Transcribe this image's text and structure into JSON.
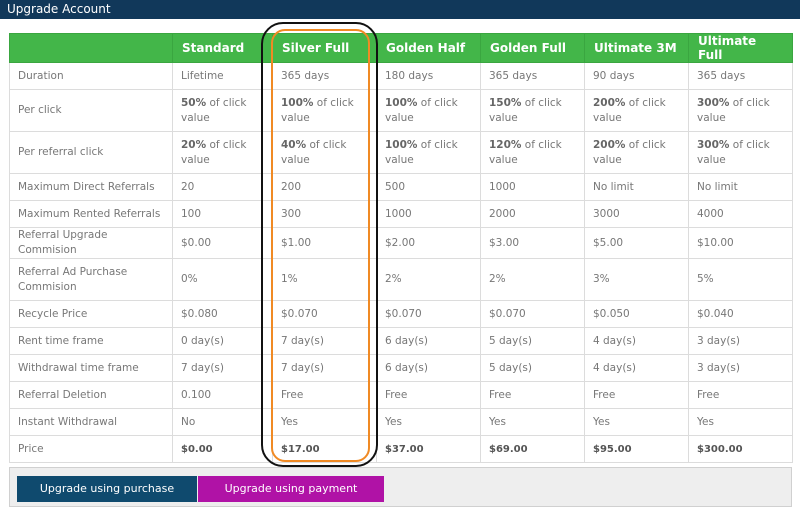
{
  "window": {
    "title": "Upgrade Account"
  },
  "table": {
    "columns": [
      "",
      "Standard",
      "Silver Full",
      "Golden Half",
      "Golden Full",
      "Ultimate 3M",
      "Ultimate Full"
    ],
    "rows": [
      {
        "label": "Duration",
        "cells": [
          {
            "text": "Lifetime"
          },
          {
            "text": "365 days"
          },
          {
            "text": "180 days"
          },
          {
            "text": "365 days"
          },
          {
            "text": "90 days"
          },
          {
            "text": "365 days"
          }
        ]
      },
      {
        "label": "Per click",
        "cells": [
          {
            "bold": "50%",
            "text": " of click value"
          },
          {
            "bold": "100%",
            "text": " of click value"
          },
          {
            "bold": "100%",
            "text": " of click value"
          },
          {
            "bold": "150%",
            "text": " of click value"
          },
          {
            "bold": "200%",
            "text": " of click value"
          },
          {
            "bold": "300%",
            "text": " of click value"
          }
        ]
      },
      {
        "label": "Per referral click",
        "cells": [
          {
            "bold": "20%",
            "text": " of click value"
          },
          {
            "bold": "40%",
            "text": " of click value"
          },
          {
            "bold": "100%",
            "text": " of click value"
          },
          {
            "bold": "120%",
            "text": " of click value"
          },
          {
            "bold": "200%",
            "text": " of click value"
          },
          {
            "bold": "300%",
            "text": " of click value"
          }
        ]
      },
      {
        "label": "Maximum Direct Referrals",
        "cells": [
          {
            "text": "20"
          },
          {
            "text": "200"
          },
          {
            "text": "500"
          },
          {
            "text": "1000"
          },
          {
            "text": "No limit"
          },
          {
            "text": "No limit"
          }
        ]
      },
      {
        "label": "Maximum Rented Referrals",
        "cells": [
          {
            "text": "100"
          },
          {
            "text": "300"
          },
          {
            "text": "1000"
          },
          {
            "text": "2000"
          },
          {
            "text": "3000"
          },
          {
            "text": "4000"
          }
        ]
      },
      {
        "label": "Referral Upgrade Commision",
        "cells": [
          {
            "text": "$0.00"
          },
          {
            "text": "$1.00"
          },
          {
            "text": "$2.00"
          },
          {
            "text": "$3.00"
          },
          {
            "text": "$5.00"
          },
          {
            "text": "$10.00"
          }
        ]
      },
      {
        "label": "Referral Ad Purchase Commision",
        "cells": [
          {
            "text": "0%"
          },
          {
            "text": "1%"
          },
          {
            "text": "2%"
          },
          {
            "text": "2%"
          },
          {
            "text": "3%"
          },
          {
            "text": "5%"
          }
        ]
      },
      {
        "label": "Recycle Price",
        "cells": [
          {
            "text": "$0.080"
          },
          {
            "text": "$0.070"
          },
          {
            "text": "$0.070"
          },
          {
            "text": "$0.070"
          },
          {
            "text": "$0.050"
          },
          {
            "text": "$0.040"
          }
        ]
      },
      {
        "label": "Rent time frame",
        "cells": [
          {
            "text": "0 day(s)"
          },
          {
            "text": "7 day(s)"
          },
          {
            "text": "6 day(s)"
          },
          {
            "text": "5 day(s)"
          },
          {
            "text": "4 day(s)"
          },
          {
            "text": "3 day(s)"
          }
        ]
      },
      {
        "label": "Withdrawal time frame",
        "cells": [
          {
            "text": "7 day(s)"
          },
          {
            "text": "7 day(s)"
          },
          {
            "text": "6 day(s)"
          },
          {
            "text": "5 day(s)"
          },
          {
            "text": "4 day(s)"
          },
          {
            "text": "3 day(s)"
          }
        ]
      },
      {
        "label": "Referral Deletion",
        "cells": [
          {
            "text": "0.100"
          },
          {
            "text": "Free"
          },
          {
            "text": "Free"
          },
          {
            "text": "Free"
          },
          {
            "text": "Free"
          },
          {
            "text": "Free"
          }
        ]
      },
      {
        "label": "Instant Withdrawal",
        "cells": [
          {
            "text": "No"
          },
          {
            "text": "Yes"
          },
          {
            "text": "Yes"
          },
          {
            "text": "Yes"
          },
          {
            "text": "Yes"
          },
          {
            "text": "Yes"
          }
        ]
      },
      {
        "label": "Price",
        "cells": [
          {
            "text": "$0.00"
          },
          {
            "text": "$17.00"
          },
          {
            "text": "$37.00"
          },
          {
            "text": "$69.00"
          },
          {
            "text": "$95.00"
          },
          {
            "text": "$300.00"
          }
        ]
      }
    ]
  },
  "actions": {
    "purchase_balance": "Upgrade using purchase balance",
    "payment_gateways": "Upgrade using payment gateways"
  },
  "colors": {
    "titlebar": "#11385a",
    "header_green": "#43b649",
    "button_blue": "#0f4a6e",
    "button_magenta": "#b012a6",
    "highlight_black": "#111111",
    "highlight_orange": "#f08a24"
  }
}
